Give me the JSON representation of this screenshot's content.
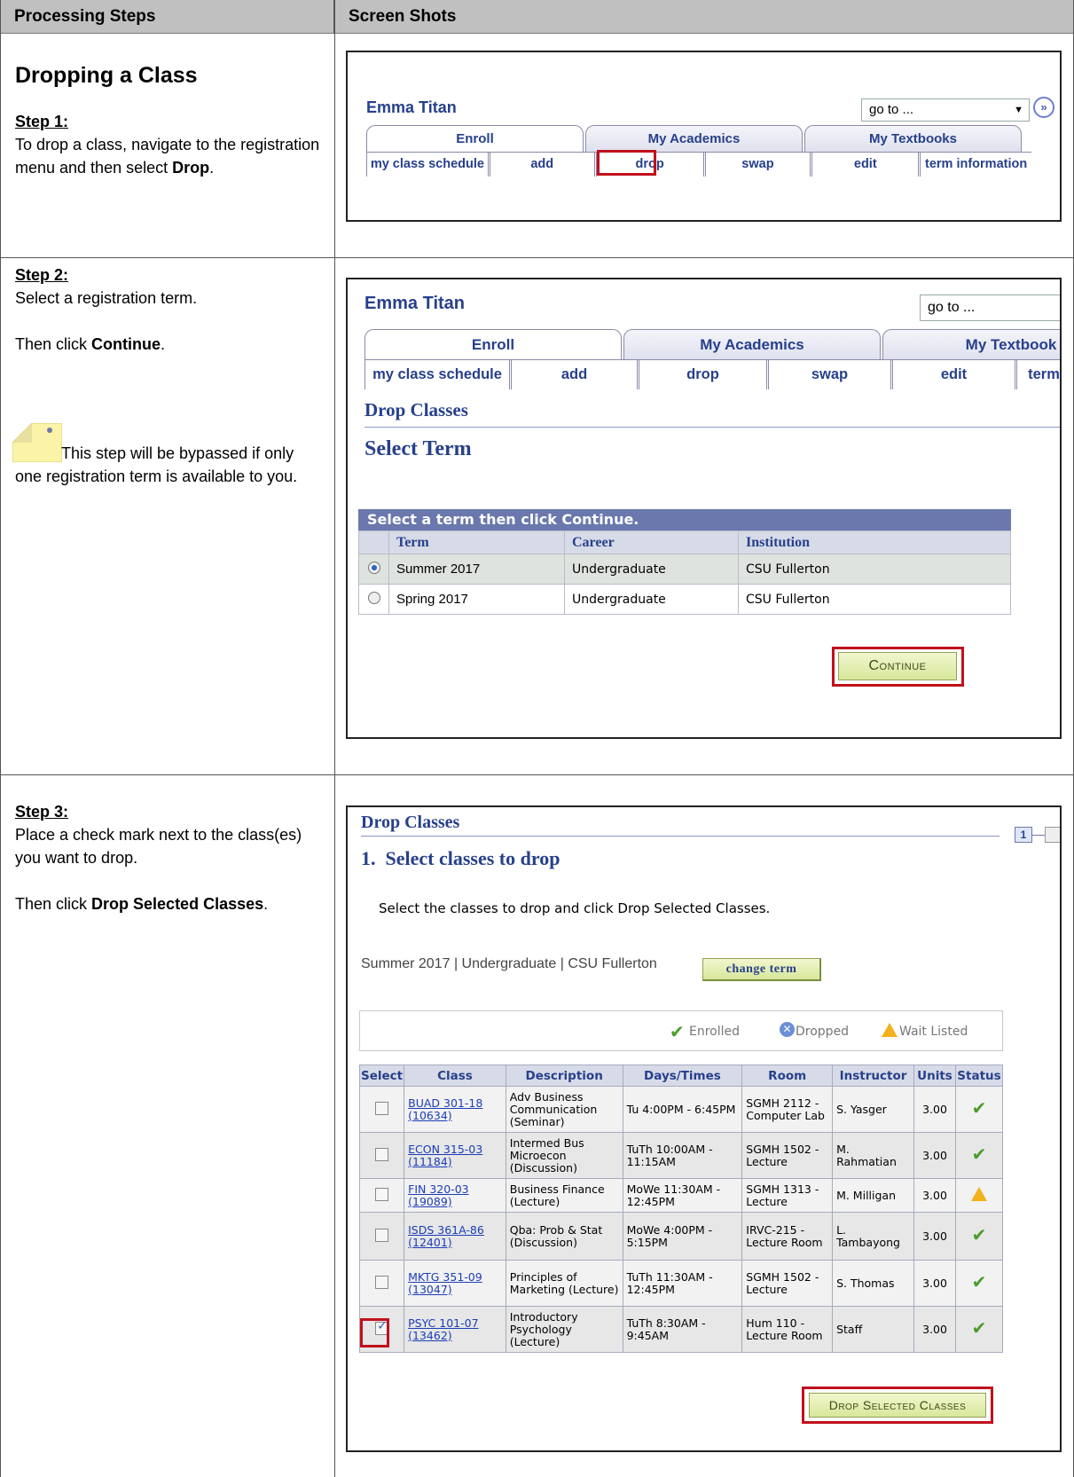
{
  "header": {
    "col1": "Processing Steps",
    "col2": "Screen Shots"
  },
  "section_title": "Dropping a Class",
  "steps": [
    {
      "heading": "Step 1:",
      "text_a": "To drop a class, navigate to the registration menu and then select ",
      "bold": "Drop",
      "text_b": "."
    },
    {
      "heading": "Step 2:",
      "line1": "Select a registration term.",
      "line2_a": "Then click ",
      "line2_bold": "Continue",
      "line2_b": ".",
      "note": "This step will be bypassed if only one registration term is available to you."
    },
    {
      "heading": "Step 3:",
      "line1": "Place a check mark next to the class(es) you want to drop.",
      "line2_a": "Then click ",
      "line2_bold": "Drop Selected Classes",
      "line2_b": "."
    }
  ],
  "shot1": {
    "name": "Emma Titan",
    "goto": "go to ...",
    "tabs": [
      "Enroll",
      "My Academics",
      "My Textbooks"
    ],
    "subs": [
      "my class schedule",
      "add",
      "drop",
      "swap",
      "edit",
      "term information"
    ]
  },
  "shot2": {
    "name": "Emma Titan",
    "goto": "go to ...",
    "tabs": [
      "Enroll",
      "My Academics",
      "My Textbook"
    ],
    "subs": [
      "my class schedule",
      "add",
      "drop",
      "swap",
      "edit",
      "term"
    ],
    "page_title": "Drop Classes",
    "sub_title": "Select Term",
    "grid_caption": "Select a term then click Continue.",
    "columns": [
      "Term",
      "Career",
      "Institution"
    ],
    "rows": [
      {
        "term": "Summer 2017",
        "career": "Undergraduate",
        "institution": "CSU Fullerton",
        "selected": true
      },
      {
        "term": "Spring 2017",
        "career": "Undergraduate",
        "institution": "CSU Fullerton",
        "selected": false
      }
    ],
    "continue_label": "Continue"
  },
  "shot3": {
    "page_title": "Drop Classes",
    "step_num": "1",
    "step_title": "1.  Select classes to drop",
    "instruction": "Select the classes to drop and click Drop Selected Classes.",
    "term_line": "Summer 2017 | Undergraduate | CSU Fullerton",
    "change_term": "change term",
    "legend": {
      "enrolled": "Enrolled",
      "dropped": "Dropped",
      "waitlisted": "Wait Listed"
    },
    "columns": [
      "Select",
      "Class",
      "Description",
      "Days/Times",
      "Room",
      "Instructor",
      "Units",
      "Status"
    ],
    "classes": [
      {
        "class": "BUAD 301-18",
        "id": "(10634)",
        "desc": "Adv Business Communication (Seminar)",
        "days": "Tu 4:00PM - 6:45PM",
        "room": "SGMH 2112 - Computer Lab",
        "instructor": "S. Yasger",
        "units": "3.00",
        "status": "enrolled",
        "checked": false
      },
      {
        "class": "ECON 315-03",
        "id": "(11184)",
        "desc": "Intermed Bus Microecon (Discussion)",
        "days": "TuTh 10:00AM - 11:15AM",
        "room": "SGMH 1502 - Lecture",
        "instructor": "M. Rahmatian",
        "units": "3.00",
        "status": "enrolled",
        "checked": false
      },
      {
        "class": "FIN 320-03",
        "id": "(19089)",
        "desc": "Business Finance (Lecture)",
        "days": "MoWe 11:30AM - 12:45PM",
        "room": "SGMH 1313 - Lecture",
        "instructor": "M. Milligan",
        "units": "3.00",
        "status": "waitlisted",
        "checked": false
      },
      {
        "class": "ISDS 361A-86",
        "id": "(12401)",
        "desc": "Qba: Prob & Stat (Discussion)",
        "days": "MoWe 4:00PM - 5:15PM",
        "room": "IRVC-215 - Lecture Room",
        "instructor": "L. Tambayong",
        "units": "3.00",
        "status": "enrolled",
        "checked": false
      },
      {
        "class": "MKTG 351-09",
        "id": "(13047)",
        "desc": "Principles of Marketing (Lecture)",
        "days": "TuTh 11:30AM - 12:45PM",
        "room": "SGMH 1502 - Lecture",
        "instructor": "S. Thomas",
        "units": "3.00",
        "status": "enrolled",
        "checked": false
      },
      {
        "class": "PSYC 101-07",
        "id": "(13462)",
        "desc": "Introductory Psychology (Lecture)",
        "days": "TuTh 8:30AM - 9:45AM",
        "room": "Hum 110 - Lecture Room",
        "instructor": "Staff",
        "units": "3.00",
        "status": "enrolled",
        "checked": true
      }
    ],
    "drop_button": "Drop Selected Classes"
  }
}
